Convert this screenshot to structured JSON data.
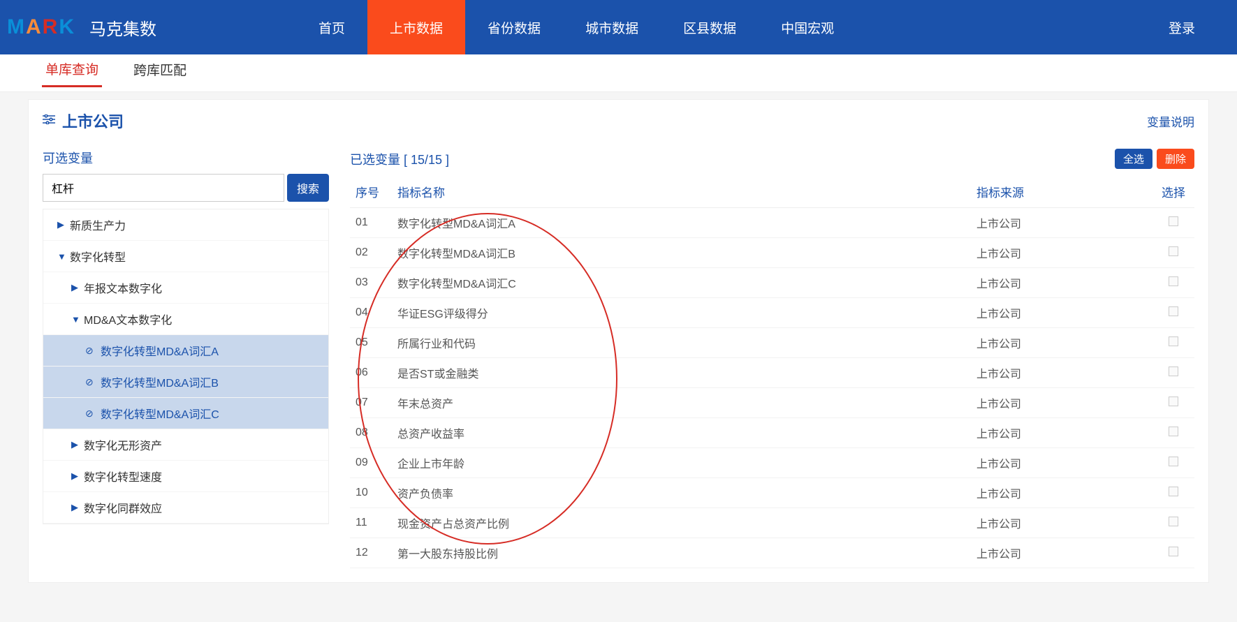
{
  "brand": "马克集数",
  "nav": {
    "items": [
      "首页",
      "上市数据",
      "省份数据",
      "城市数据",
      "区县数据",
      "中国宏观"
    ],
    "activeIndex": 1,
    "login": "登录"
  },
  "subtabs": {
    "items": [
      "单库查询",
      "跨库匹配"
    ],
    "activeIndex": 0
  },
  "section": {
    "title": "上市公司",
    "varDesc": "变量说明"
  },
  "left": {
    "panelTitle": "可选变量",
    "searchValue": "杠杆",
    "searchBtn": "搜索",
    "tree": [
      {
        "label": "新质生产力",
        "level": 1,
        "state": "collapsed"
      },
      {
        "label": "数字化转型",
        "level": 1,
        "state": "expanded"
      },
      {
        "label": "年报文本数字化",
        "level": 2,
        "state": "collapsed"
      },
      {
        "label": "MD&A文本数字化",
        "level": 2,
        "state": "expanded"
      },
      {
        "label": "数字化转型MD&A词汇A",
        "level": 4,
        "selected": true
      },
      {
        "label": "数字化转型MD&A词汇B",
        "level": 4,
        "selected": true
      },
      {
        "label": "数字化转型MD&A词汇C",
        "level": 4,
        "selected": true
      },
      {
        "label": "数字化无形资产",
        "level": 2,
        "state": "collapsed"
      },
      {
        "label": "数字化转型速度",
        "level": 2,
        "state": "collapsed"
      },
      {
        "label": "数字化同群效应",
        "level": 2,
        "state": "collapsed"
      }
    ]
  },
  "right": {
    "countLabel": "已选变量 [ 15/15 ]",
    "selectAll": "全选",
    "delete": "删除",
    "cols": {
      "seq": "序号",
      "name": "指标名称",
      "src": "指标来源",
      "sel": "选择"
    },
    "rows": [
      {
        "seq": "01",
        "name": "数字化转型MD&A词汇A",
        "src": "上市公司"
      },
      {
        "seq": "02",
        "name": "数字化转型MD&A词汇B",
        "src": "上市公司"
      },
      {
        "seq": "03",
        "name": "数字化转型MD&A词汇C",
        "src": "上市公司"
      },
      {
        "seq": "04",
        "name": "华证ESG评级得分",
        "src": "上市公司"
      },
      {
        "seq": "05",
        "name": "所属行业和代码",
        "src": "上市公司"
      },
      {
        "seq": "06",
        "name": "是否ST或金融类",
        "src": "上市公司"
      },
      {
        "seq": "07",
        "name": "年末总资产",
        "src": "上市公司"
      },
      {
        "seq": "08",
        "name": "总资产收益率",
        "src": "上市公司"
      },
      {
        "seq": "09",
        "name": "企业上市年龄",
        "src": "上市公司"
      },
      {
        "seq": "10",
        "name": "资产负债率",
        "src": "上市公司"
      },
      {
        "seq": "11",
        "name": "现金资产占总资产比例",
        "src": "上市公司"
      },
      {
        "seq": "12",
        "name": "第一大股东持股比例",
        "src": "上市公司"
      }
    ]
  }
}
